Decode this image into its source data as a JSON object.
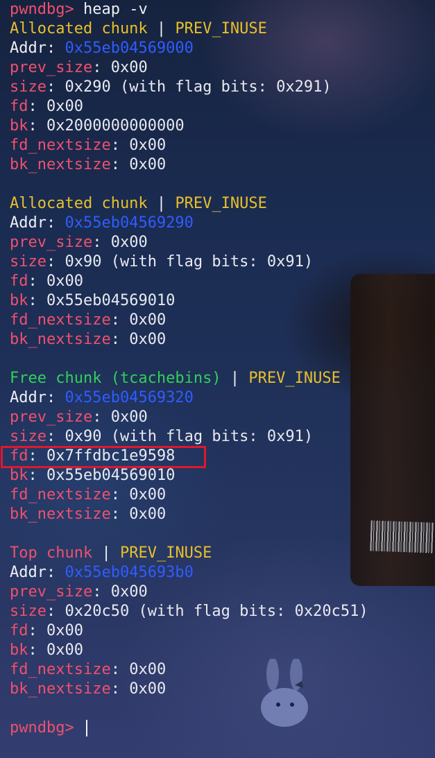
{
  "prompt": "pwndbg>",
  "command": "heap -v",
  "chunks": [
    {
      "type": "Allocated chunk",
      "flag": "PREV_INUSE",
      "addr": "0x55eb04569000",
      "prev_size": "0x00",
      "size": "0x290 (with flag bits: 0x291)",
      "fd": "0x00",
      "bk": "0x2000000000000",
      "fd_nextsize": "0x00",
      "bk_nextsize": "0x00"
    },
    {
      "type": "Allocated chunk",
      "flag": "PREV_INUSE",
      "addr": "0x55eb04569290",
      "prev_size": "0x00",
      "size": "0x90 (with flag bits: 0x91)",
      "fd": "0x00",
      "bk": "0x55eb04569010",
      "fd_nextsize": "0x00",
      "bk_nextsize": "0x00"
    },
    {
      "type": "Free chunk (tcachebins)",
      "flag": "PREV_INUSE",
      "addr": "0x55eb04569320",
      "prev_size": "0x00",
      "size": "0x90 (with flag bits: 0x91)",
      "fd": "0x7ffdbc1e9598",
      "bk": "0x55eb04569010",
      "fd_nextsize": "0x00",
      "bk_nextsize": "0x00"
    },
    {
      "type": "Top chunk",
      "flag": "PREV_INUSE",
      "addr": "0x55eb045693b0",
      "prev_size": "0x00",
      "size": "0x20c50 (with flag bits: 0x20c51)",
      "fd": "0x00",
      "bk": "0x00",
      "fd_nextsize": "0x00",
      "bk_nextsize": "0x00"
    }
  ],
  "labels": {
    "addr": "Addr",
    "prev_size": "prev_size",
    "size": "size",
    "fd": "fd",
    "bk": "bk",
    "fd_nextsize": "fd_nextsize",
    "bk_nextsize": "bk_nextsize",
    "separator": " | ",
    "colon": ": "
  },
  "colors": {
    "prompt": "#f0506e",
    "allocated": "#e8c02a",
    "free": "#30d158",
    "top": "#f0506e",
    "field_name": "#f0506e",
    "address": "#2f5dff",
    "highlight_border": "#e0182c"
  }
}
